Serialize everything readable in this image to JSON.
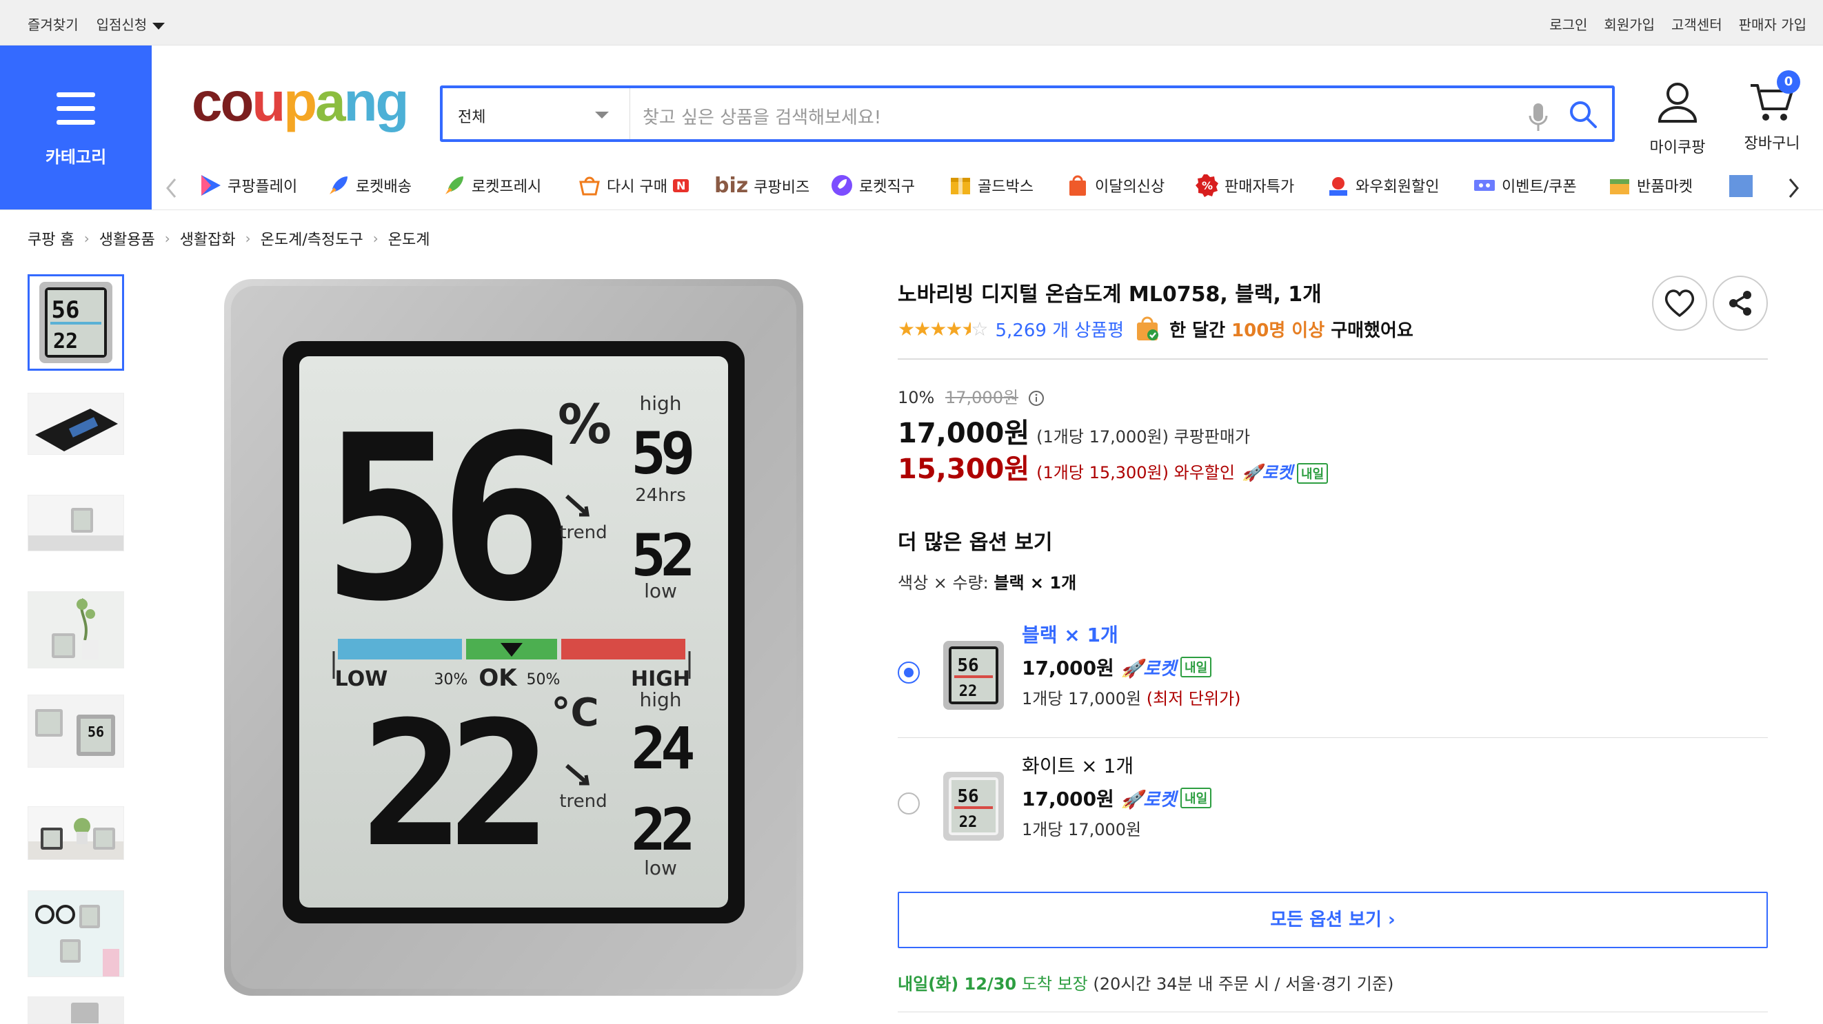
{
  "topbar": {
    "bookmark": "즐겨찾기",
    "seller_apply": "입점신청",
    "login": "로그인",
    "signup": "회원가입",
    "customer_center": "고객센터",
    "seller_signup": "판매자 가입"
  },
  "header": {
    "category_label": "카테고리",
    "logo": [
      "c",
      "o",
      "u",
      "p",
      "a",
      "n",
      "g"
    ],
    "search_scope": "전체",
    "search_placeholder": "찾고 싶은 상품을 검색해보세요!",
    "mypage": "마이쿠팡",
    "cart": "장바구니",
    "cart_count": "0"
  },
  "nav": {
    "items": [
      {
        "label": "쿠팡플레이",
        "icon": "play-icon"
      },
      {
        "label": "로켓배송",
        "icon": "rocket-icon"
      },
      {
        "label": "로켓프레시",
        "icon": "rocket-fresh-icon"
      },
      {
        "label": "다시 구매",
        "icon": "repurchase-icon",
        "badge": "N"
      },
      {
        "label": "쿠팡비즈",
        "icon": "biz-icon",
        "prefix": "biz"
      },
      {
        "label": "로켓직구",
        "icon": "rocket-global-icon"
      },
      {
        "label": "골드박스",
        "icon": "goldbox-icon"
      },
      {
        "label": "이달의신상",
        "icon": "new-bag-icon"
      },
      {
        "label": "판매자특가",
        "icon": "discount-icon"
      },
      {
        "label": "와우회원할인",
        "icon": "wow-icon"
      },
      {
        "label": "이벤트/쿠폰",
        "icon": "coupon-icon"
      },
      {
        "label": "반품마켓",
        "icon": "return-market-icon"
      }
    ]
  },
  "breadcrumb": [
    "쿠팡 홈",
    "생활용품",
    "생활잡화",
    "온도계/측정도구",
    "온도계"
  ],
  "product": {
    "title": "노바리빙 디지털 온습도계 ML0758, 블랙, 1개",
    "rating": 4.5,
    "review_count": "5,269 개 상품평",
    "bought_prefix": "한 달간",
    "bought_highlight": "100명 이상",
    "bought_suffix": "구매했어요",
    "discount_rate": "10%",
    "original_price": "17,000원",
    "coupang_price": "17,000원",
    "coupang_price_unit": "(1개당 17,000원)",
    "coupang_price_label": "쿠팡판매가",
    "wow_price": "15,300원",
    "wow_price_unit": "(1개당 15,300원)",
    "wow_price_label": "와우할인",
    "rocket_label": "로켓",
    "tomorrow_label": "내일"
  },
  "display": {
    "humidity": "56",
    "humidity_unit": "%",
    "high_label": "high",
    "humidity_high": "59",
    "hours_label": "24hrs",
    "humidity_low": "52",
    "low_label": "low",
    "trend_label": "trend",
    "scale_low": "LOW",
    "scale_30": "30%",
    "scale_ok": "OK",
    "scale_50": "50%",
    "scale_high": "HIGH",
    "temperature": "22",
    "temp_unit": "°C",
    "temp_high": "24",
    "temp_low": "22"
  },
  "options": {
    "heading": "더 많은 옵션 보기",
    "selected_label": "색상 × 수량:",
    "selected_value": "블랙 × 1개",
    "list": [
      {
        "name": "블랙 × 1개",
        "price": "17,000원",
        "unit": "1개당 17,000원",
        "note": "(최저 단위가)",
        "selected": true
      },
      {
        "name": "화이트 × 1개",
        "price": "17,000원",
        "unit": "1개당 17,000원",
        "note": "",
        "selected": false
      }
    ],
    "view_all": "모든 옵션 보기 ›"
  },
  "delivery": {
    "date": "내일(화) 12/30",
    "guarantee": "도착 보장",
    "detail": "(20시간 34분 내 주문 시 / 서울·경기 기준)"
  },
  "colors": {
    "accent": "#346aff",
    "price_red": "#ae0000",
    "rocket_green": "#2d9e41",
    "star": "#f5a623"
  }
}
